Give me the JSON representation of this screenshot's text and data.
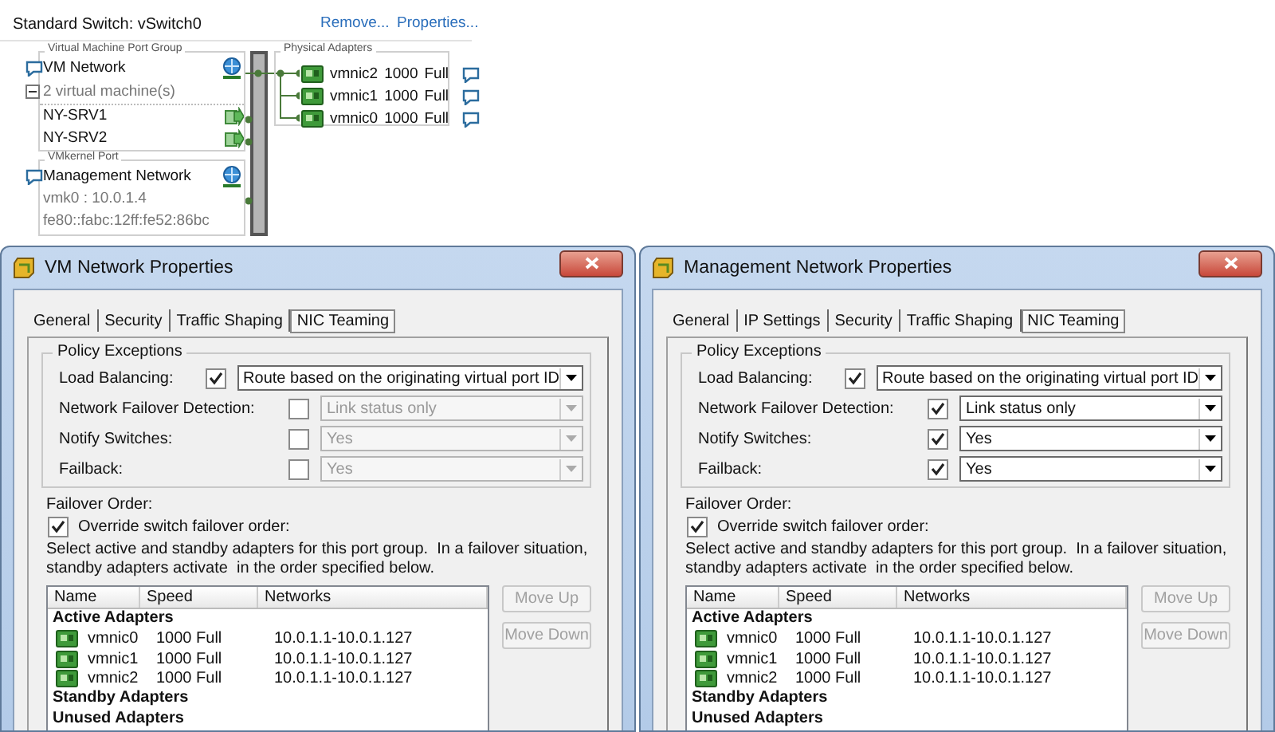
{
  "switch": {
    "title": "Standard Switch: vSwitch0",
    "actions": [
      "Remove...",
      "Properties..."
    ],
    "port_groups": [
      {
        "kind": "vm",
        "caption": "Virtual Machine Port Group",
        "name": "VM Network",
        "summary": "2 virtual machine(s)",
        "expanded": true,
        "vms": [
          "NY-SRV1",
          "NY-SRV2"
        ]
      },
      {
        "kind": "vmkernel",
        "caption": "VMkernel Port",
        "name": "Management Network",
        "details": [
          "vmk0 : 10.0.1.4",
          "fe80::fabc:12ff:fe52:86bc"
        ]
      }
    ],
    "physical_adapters": {
      "caption": "Physical Adapters",
      "items": [
        {
          "name": "vmnic2",
          "speed": "1000",
          "duplex": "Full"
        },
        {
          "name": "vmnic1",
          "speed": "1000",
          "duplex": "Full"
        },
        {
          "name": "vmnic0",
          "speed": "1000",
          "duplex": "Full"
        }
      ]
    }
  },
  "dialogs": [
    {
      "title": "VM Network Properties",
      "tabs": [
        {
          "label": "General",
          "selected": false
        },
        {
          "label": "Security",
          "selected": false
        },
        {
          "label": "Traffic Shaping",
          "selected": false
        },
        {
          "label": "NIC Teaming",
          "selected": true
        }
      ],
      "policy": {
        "caption": "Policy Exceptions",
        "rows": [
          {
            "label": "Load Balancing:",
            "checked": true,
            "value": "Route based on the originating virtual port ID"
          },
          {
            "label": "Network Failover Detection:",
            "checked": false,
            "value": "Link status only"
          },
          {
            "label": "Notify Switches:",
            "checked": false,
            "value": "Yes"
          },
          {
            "label": "Failback:",
            "checked": false,
            "value": "Yes"
          }
        ]
      },
      "failover": {
        "caption": "Failover Order:",
        "override": {
          "label": "Override switch failover order:",
          "checked": true
        },
        "description": "Select active and standby adapters for this port group.  In a failover situation, standby adapters activate  in the order specified below.",
        "columns": [
          "Name",
          "Speed",
          "Networks"
        ],
        "groups": [
          {
            "label": "Active Adapters",
            "adapters": [
              {
                "name": "vmnic0",
                "speed": "1000 Full",
                "networks": "10.0.1.1-10.0.1.127"
              },
              {
                "name": "vmnic1",
                "speed": "1000 Full",
                "networks": "10.0.1.1-10.0.1.127"
              },
              {
                "name": "vmnic2",
                "speed": "1000 Full",
                "networks": "10.0.1.1-10.0.1.127"
              }
            ]
          },
          {
            "label": "Standby Adapters"
          },
          {
            "label": "Unused Adapters"
          }
        ]
      },
      "buttons": [
        {
          "label": "Move Up",
          "disabled": true
        },
        {
          "label": "Move Down",
          "disabled": true
        }
      ]
    },
    {
      "title": "Management Network Properties",
      "tabs": [
        {
          "label": "General",
          "selected": false
        },
        {
          "label": "IP Settings",
          "selected": false
        },
        {
          "label": "Security",
          "selected": false
        },
        {
          "label": "Traffic Shaping",
          "selected": false
        },
        {
          "label": "NIC Teaming",
          "selected": true
        }
      ],
      "policy": {
        "caption": "Policy Exceptions",
        "rows": [
          {
            "label": "Load Balancing:",
            "checked": true,
            "value": "Route based on the originating virtual port ID"
          },
          {
            "label": "Network Failover Detection:",
            "checked": true,
            "value": "Link status only"
          },
          {
            "label": "Notify Switches:",
            "checked": true,
            "value": "Yes"
          },
          {
            "label": "Failback:",
            "checked": true,
            "value": "Yes"
          }
        ]
      },
      "failover": {
        "caption": "Failover Order:",
        "override": {
          "label": "Override switch failover order:",
          "checked": true
        },
        "description": "Select active and standby adapters for this port group.  In a failover situation, standby adapters activate  in the order specified below.",
        "columns": [
          "Name",
          "Speed",
          "Networks"
        ],
        "groups": [
          {
            "label": "Active Adapters",
            "adapters": [
              {
                "name": "vmnic0",
                "speed": "1000 Full",
                "networks": "10.0.1.1-10.0.1.127"
              },
              {
                "name": "vmnic1",
                "speed": "1000 Full",
                "networks": "10.0.1.1-10.0.1.127"
              },
              {
                "name": "vmnic2",
                "speed": "1000 Full",
                "networks": "10.0.1.1-10.0.1.127"
              }
            ]
          },
          {
            "label": "Standby Adapters"
          },
          {
            "label": "Unused Adapters"
          }
        ]
      },
      "buttons": [
        {
          "label": "Move Up",
          "disabled": true
        },
        {
          "label": "Move Down",
          "disabled": true
        }
      ]
    }
  ]
}
